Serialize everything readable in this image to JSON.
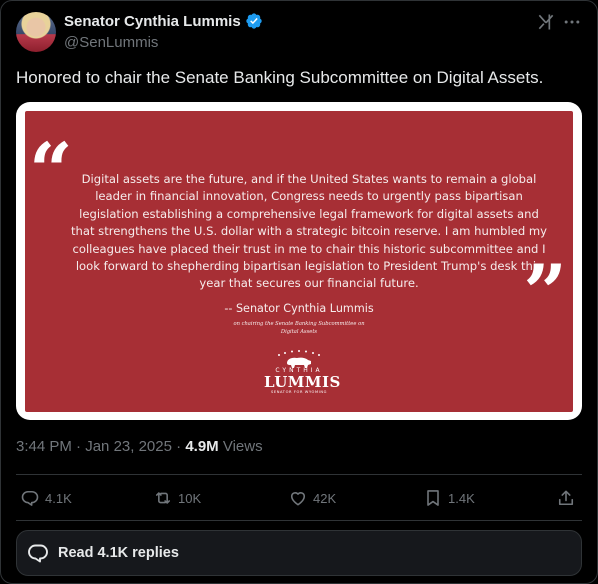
{
  "author": {
    "display_name": "Senator Cynthia Lummis",
    "handle": "@SenLummis",
    "verified_icon": "verified-badge-icon"
  },
  "tweet": {
    "text": "Honored to chair the Senate Banking Subcommittee on Digital Assets."
  },
  "media": {
    "quote_open": "“",
    "quote_close": "”",
    "quote_lines": [
      "Digital assets are the future, and if the United States wants to remain a global",
      "leader in financial innovation, Congress needs to urgently pass bipartisan",
      "legislation establishing a comprehensive legal framework for digital assets and",
      "that strengthens the U.S. dollar with a strategic bitcoin reserve. I am humbled my",
      "colleagues have placed their trust in me to chair this historic subcommittee and I",
      "look forward to shepherding bipartisan legislation to President Trump's desk this",
      "year that secures our financial future."
    ],
    "attribution": "-- Senator Cynthia Lummis",
    "attribution_sub_1": "on chairing the Senate Banking Subcommittee on",
    "attribution_sub_2": "Digital Assets",
    "logo_small": "CYNTHIA",
    "logo_big": "LUMMIS",
    "logo_tag": "SENATOR FOR WYOMING",
    "background_color": "#a72f35"
  },
  "meta": {
    "time": "3:44 PM",
    "separator": " · ",
    "date": "Jan 23, 2025",
    "views_count": "4.9M",
    "views_label": " Views"
  },
  "actions": {
    "replies": "4.1K",
    "reposts": "10K",
    "likes": "42K",
    "bookmarks": "1.4K"
  },
  "read_replies_label": "Read 4.1K replies",
  "colors": {
    "background": "#000000",
    "text_primary": "#e7e9ea",
    "text_secondary": "#71767b",
    "verified_blue": "#1d9bf0",
    "border": "#2f3336"
  }
}
